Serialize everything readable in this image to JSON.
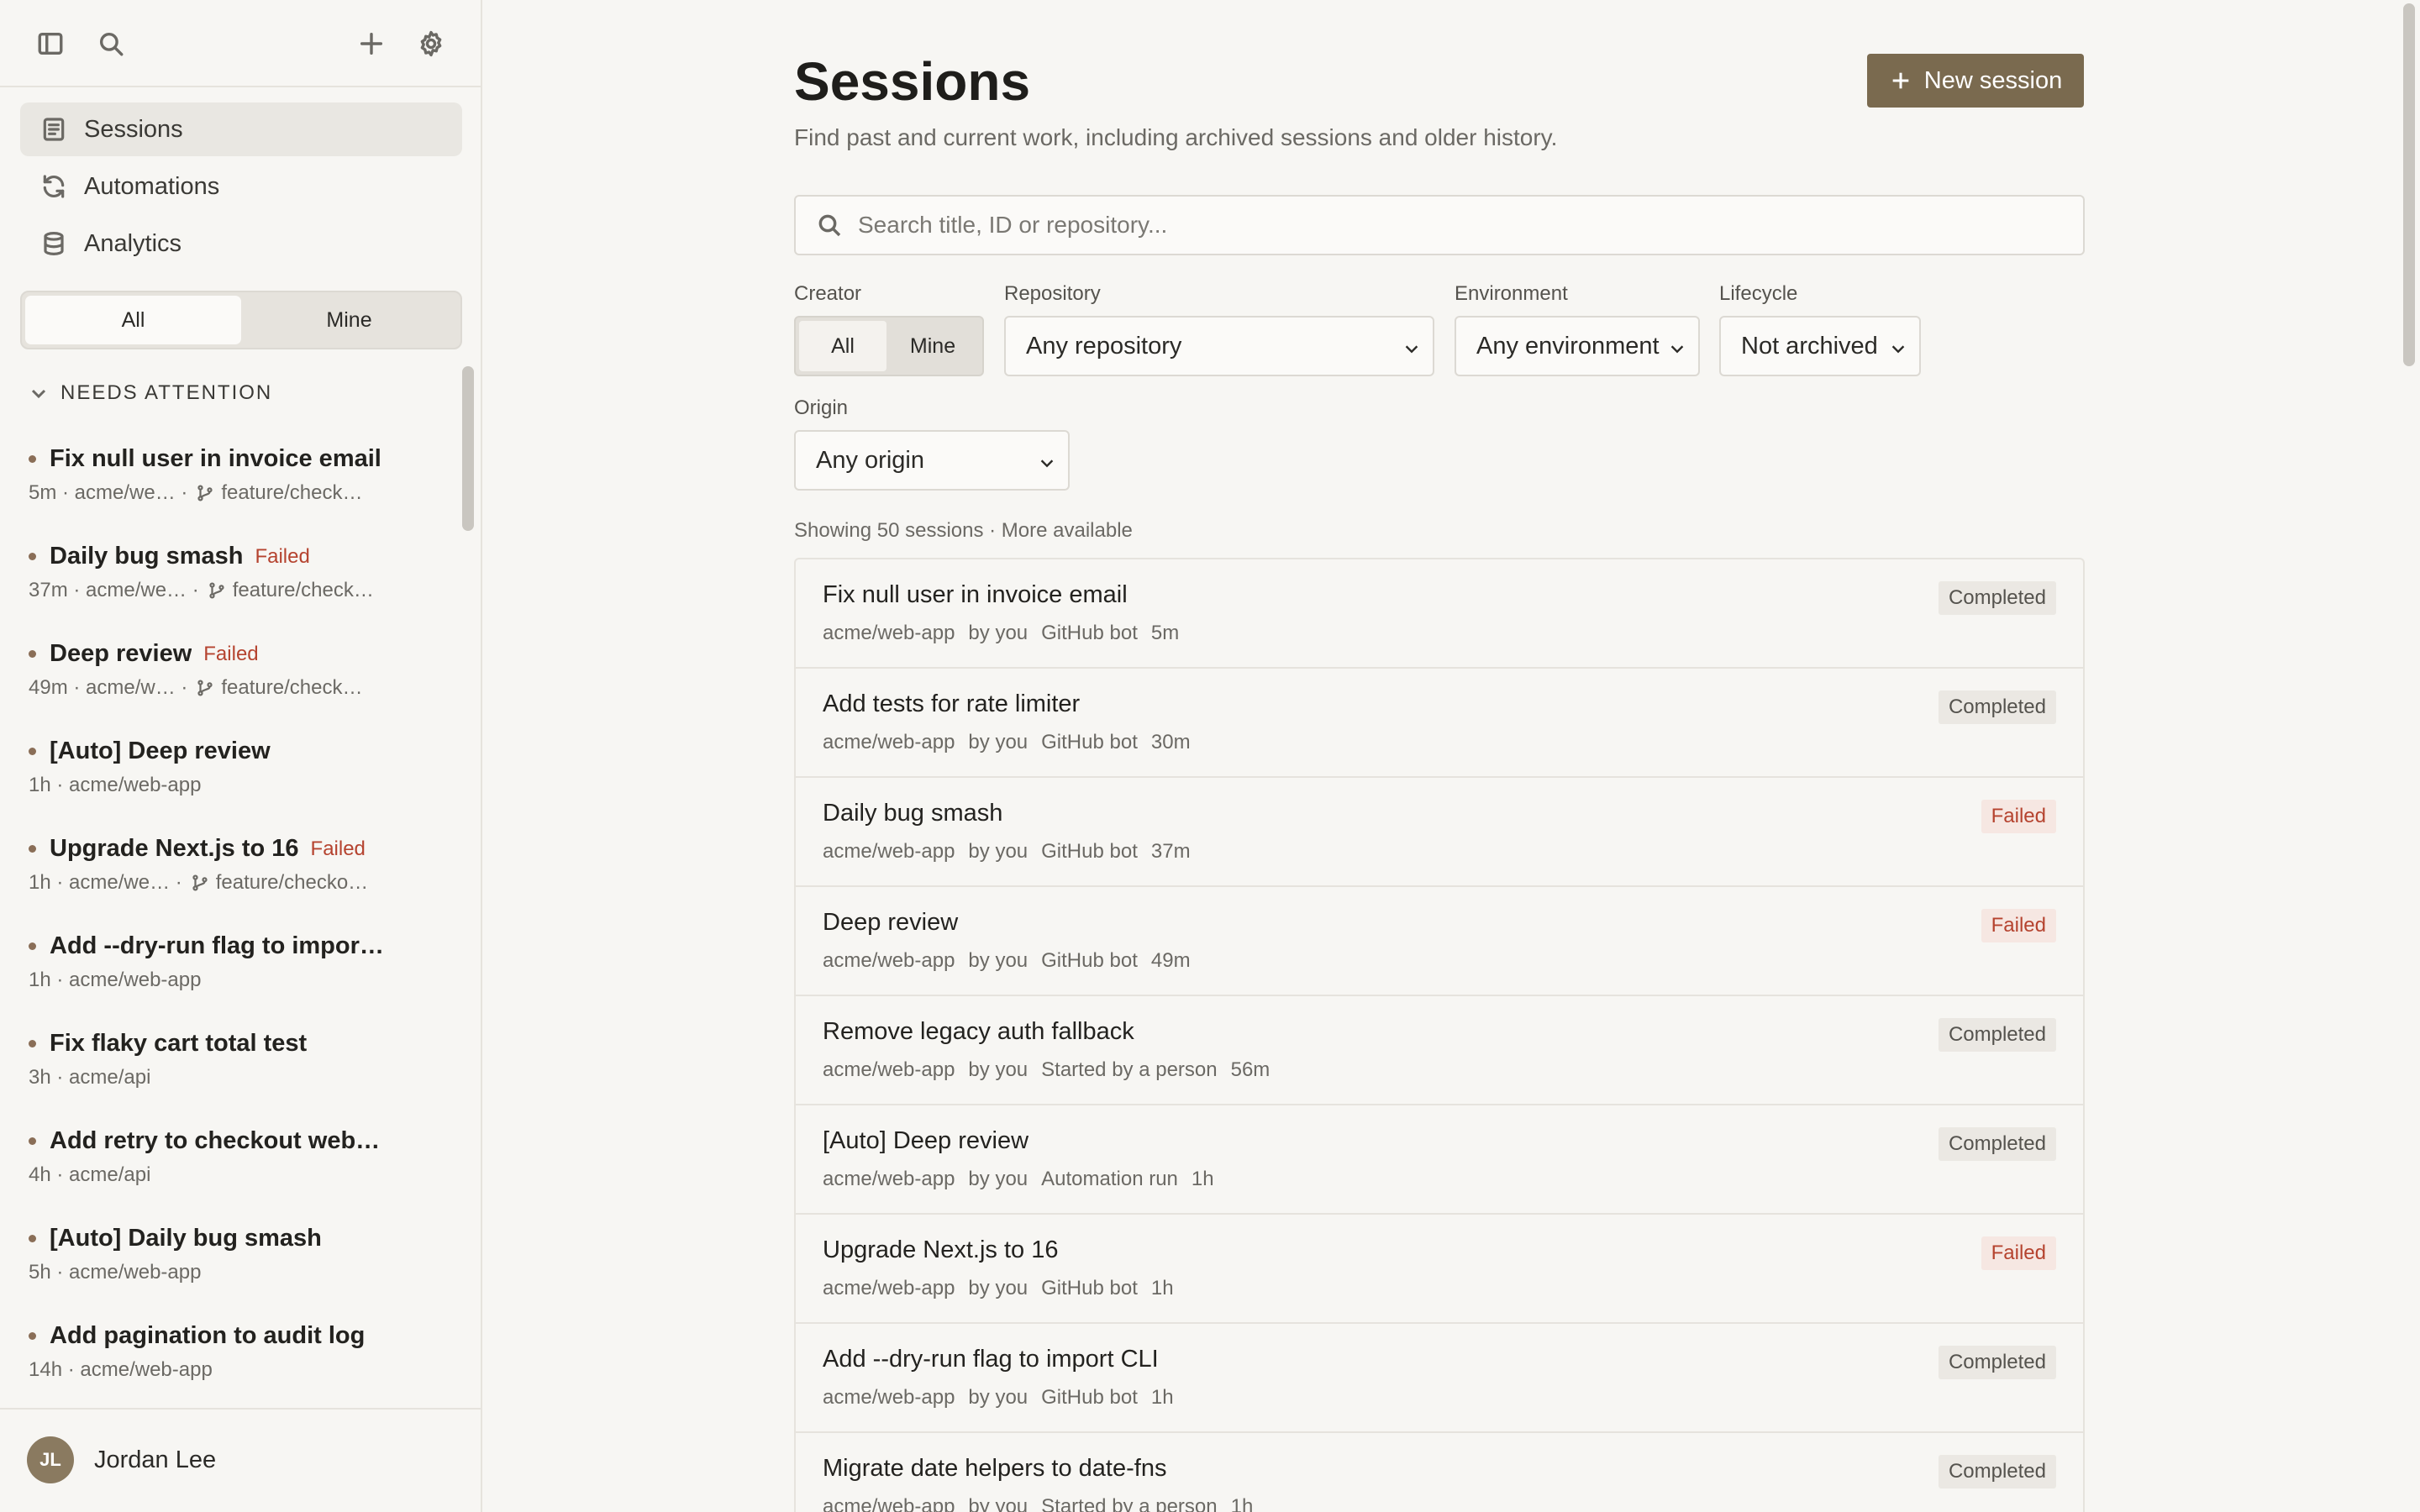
{
  "sidebar": {
    "nav": [
      {
        "label": "Sessions",
        "icon": "document-icon",
        "active": true
      },
      {
        "label": "Automations",
        "icon": "refresh-icon",
        "active": false
      },
      {
        "label": "Analytics",
        "icon": "database-icon",
        "active": false
      }
    ],
    "filter": {
      "all": "All",
      "mine": "Mine",
      "selected": "All"
    },
    "section_title": "NEEDS ATTENTION",
    "items": [
      {
        "title": "Fix null user in invoice email",
        "status": "",
        "age": "5m",
        "repo": "acme/we…",
        "branch": "feature/check…"
      },
      {
        "title": "Daily bug smash",
        "status": "Failed",
        "age": "37m",
        "repo": "acme/we…",
        "branch": "feature/check…"
      },
      {
        "title": "Deep review",
        "status": "Failed",
        "age": "49m",
        "repo": "acme/w…",
        "branch": "feature/check…"
      },
      {
        "title": "[Auto] Deep review",
        "status": "",
        "age": "1h",
        "repo": "acme/web-app",
        "branch": ""
      },
      {
        "title": "Upgrade Next.js to 16",
        "status": "Failed",
        "age": "1h",
        "repo": "acme/we…",
        "branch": "feature/checko…"
      },
      {
        "title": "Add --dry-run flag to impor…",
        "status": "",
        "age": "1h",
        "repo": "acme/web-app",
        "branch": ""
      },
      {
        "title": "Fix flaky cart total test",
        "status": "",
        "age": "3h",
        "repo": "acme/api",
        "branch": ""
      },
      {
        "title": "Add retry to checkout web…",
        "status": "",
        "age": "4h",
        "repo": "acme/api",
        "branch": ""
      },
      {
        "title": "[Auto] Daily bug smash",
        "status": "",
        "age": "5h",
        "repo": "acme/web-app",
        "branch": ""
      },
      {
        "title": "Add pagination to audit log",
        "status": "",
        "age": "14h",
        "repo": "acme/web-app",
        "branch": ""
      }
    ],
    "user": {
      "initials": "JL",
      "name": "Jordan Lee"
    }
  },
  "main": {
    "title": "Sessions",
    "subtitle": "Find past and current work, including archived sessions and older history.",
    "new_button": "New session",
    "search_placeholder": "Search title, ID or repository...",
    "filters": {
      "creator_label": "Creator",
      "creator_all": "All",
      "creator_mine": "Mine",
      "repository_label": "Repository",
      "repository_value": "Any repository",
      "environment_label": "Environment",
      "environment_value": "Any environment",
      "lifecycle_label": "Lifecycle",
      "lifecycle_value": "Not archived",
      "origin_label": "Origin",
      "origin_value": "Any origin"
    },
    "showing": "Showing 50 sessions · More available",
    "sessions": [
      {
        "title": "Fix null user in invoice email",
        "repo": "acme/web-app",
        "by": "by you",
        "origin": "GitHub bot",
        "age": "5m",
        "status": "Completed"
      },
      {
        "title": "Add tests for rate limiter",
        "repo": "acme/web-app",
        "by": "by you",
        "origin": "GitHub bot",
        "age": "30m",
        "status": "Completed"
      },
      {
        "title": "Daily bug smash",
        "repo": "acme/web-app",
        "by": "by you",
        "origin": "GitHub bot",
        "age": "37m",
        "status": "Failed"
      },
      {
        "title": "Deep review",
        "repo": "acme/web-app",
        "by": "by you",
        "origin": "GitHub bot",
        "age": "49m",
        "status": "Failed"
      },
      {
        "title": "Remove legacy auth fallback",
        "repo": "acme/web-app",
        "by": "by you",
        "origin": "Started by a person",
        "age": "56m",
        "status": "Completed"
      },
      {
        "title": "[Auto] Deep review",
        "repo": "acme/web-app",
        "by": "by you",
        "origin": "Automation run",
        "age": "1h",
        "status": "Completed"
      },
      {
        "title": "Upgrade Next.js to 16",
        "repo": "acme/web-app",
        "by": "by you",
        "origin": "GitHub bot",
        "age": "1h",
        "status": "Failed"
      },
      {
        "title": "Add --dry-run flag to import CLI",
        "repo": "acme/web-app",
        "by": "by you",
        "origin": "GitHub bot",
        "age": "1h",
        "status": "Completed"
      },
      {
        "title": "Migrate date helpers to date-fns",
        "repo": "acme/web-app",
        "by": "by you",
        "origin": "Started by a person",
        "age": "1h",
        "status": "Completed"
      }
    ]
  },
  "colors": {
    "accent": "#7a6a4f",
    "failed": "#b5432f",
    "background": "#f7f6f3"
  }
}
